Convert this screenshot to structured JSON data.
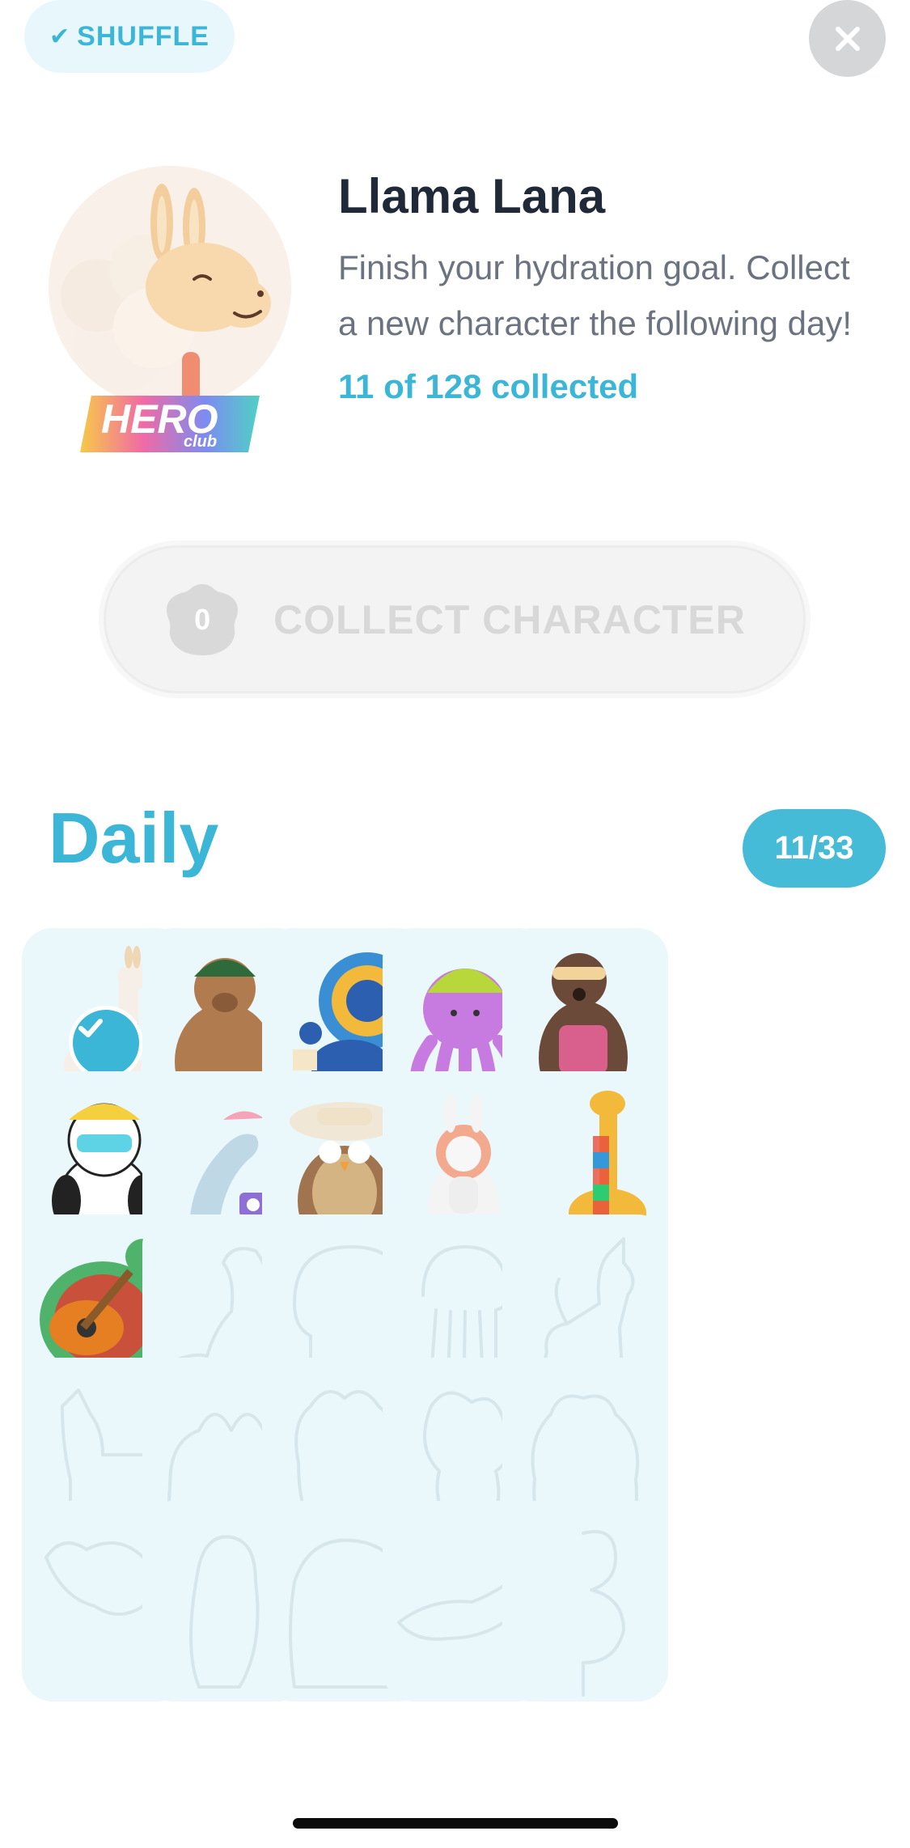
{
  "header": {
    "shuffle_label": "SHUFFLE",
    "close_icon": "close-icon",
    "shuffle_icon": "check-icon"
  },
  "character": {
    "name": "Llama Lana",
    "description": "Finish your hydration goal. Collect a new character the following day!",
    "collected": "11 of 128 collected",
    "badge_main": "HERO",
    "badge_sub": "club"
  },
  "collect_button": {
    "label": "COLLECT CHARACTER",
    "coin_value": "0"
  },
  "daily": {
    "title": "Daily",
    "count": "11/33",
    "characters": [
      {
        "name": "llama",
        "collected": true,
        "selected": true
      },
      {
        "name": "bear",
        "collected": true
      },
      {
        "name": "peacock",
        "collected": true
      },
      {
        "name": "octopus",
        "collected": true
      },
      {
        "name": "otter",
        "collected": true
      },
      {
        "name": "panda",
        "collected": true
      },
      {
        "name": "dolphin",
        "collected": true
      },
      {
        "name": "owl",
        "collected": true
      },
      {
        "name": "bunny",
        "collected": true
      },
      {
        "name": "giraffe",
        "collected": true
      },
      {
        "name": "turtle",
        "collected": true
      },
      {
        "name": "dinosaur",
        "collected": false
      },
      {
        "name": "elephant",
        "collected": false
      },
      {
        "name": "jellyfish",
        "collected": false
      },
      {
        "name": "unicorn",
        "collected": false
      },
      {
        "name": "goat",
        "collected": false
      },
      {
        "name": "camel",
        "collected": false
      },
      {
        "name": "hamster",
        "collected": false
      },
      {
        "name": "squirrel",
        "collected": false
      },
      {
        "name": "bear-cub",
        "collected": false
      },
      {
        "name": "bird",
        "collected": false
      },
      {
        "name": "penguin",
        "collected": false
      },
      {
        "name": "hippo",
        "collected": false
      },
      {
        "name": "crocodile",
        "collected": false
      },
      {
        "name": "flamingo",
        "collected": false
      }
    ]
  },
  "colors": {
    "accent": "#3bb6d6",
    "cell_bg": "#eaf8fb",
    "muted_text": "#6b7280",
    "disabled": "#d8d8d8"
  }
}
